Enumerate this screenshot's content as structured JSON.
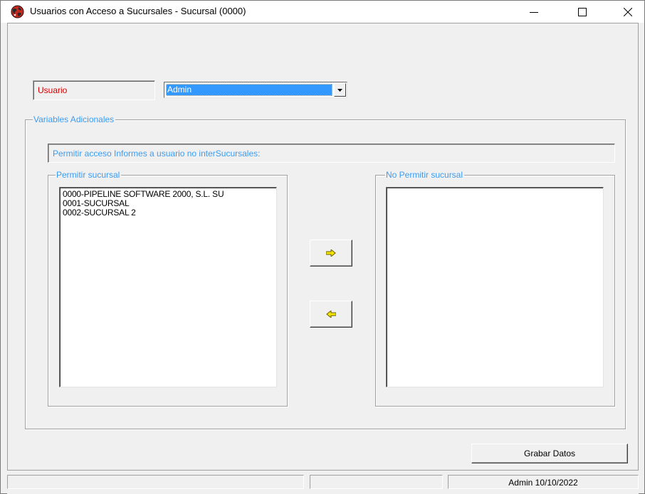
{
  "window": {
    "title": "Usuarios con Acceso a Sucursales - Sucursal (0000)",
    "icon": "globe-app-icon",
    "controls": [
      "minimize-icon",
      "maximize-icon",
      "close-icon"
    ]
  },
  "usuario": {
    "label": "Usuario",
    "selected": "Admin"
  },
  "variables": {
    "group_label": "Variables Adicionales",
    "info_text": "Permitir acceso Informes a usuario no interSucursales:"
  },
  "permitir": {
    "group_label": "Permitir sucursal",
    "items": [
      "0000-PIPELINE SOFTWARE 2000, S.L. SU",
      "0001-SUCURSAL",
      "0002-SUCURSAL 2"
    ]
  },
  "no_permitir": {
    "group_label": "No Permitir sucursal",
    "items": []
  },
  "buttons": {
    "move_right_icon": "arrow-right-icon",
    "move_left_icon": "arrow-left-icon",
    "save_label": "Grabar Datos"
  },
  "status": {
    "panel1": "",
    "panel2": "",
    "panel3": "Admin 10/10/2022"
  },
  "colors": {
    "label_red": "#d40000",
    "accent_blue": "#3c9cf0",
    "selection": "#3399ff",
    "arrow_yellow": "#f5e600"
  }
}
